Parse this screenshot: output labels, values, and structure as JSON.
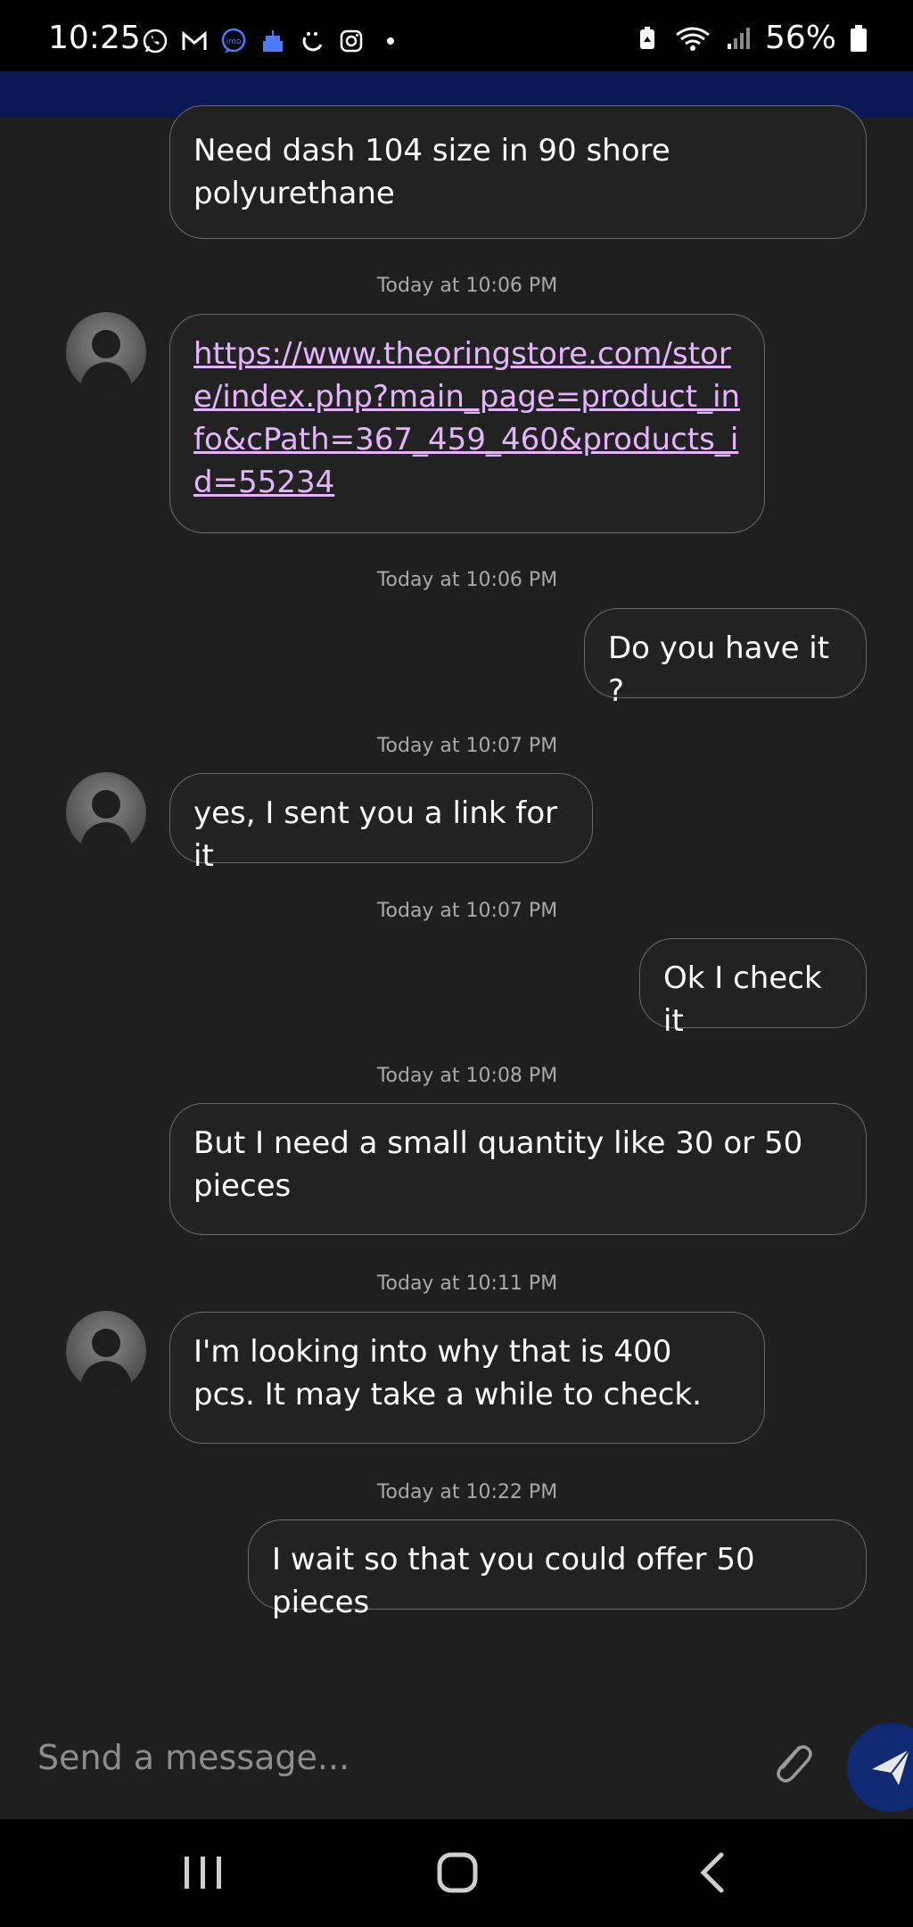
{
  "status_bar": {
    "time": "10:25",
    "battery": "56%",
    "icons": [
      "whatsapp-icon",
      "gmail-icon",
      "imo-icon",
      "cake-icon",
      "smile-app-icon",
      "instagram-icon",
      "dot-icon",
      "battery-saver-icon",
      "wifi-icon",
      "signal-icon",
      "battery-icon"
    ]
  },
  "chat": {
    "messages": [
      {
        "side": "right",
        "text": "Need dash 104 size in 90 shore polyurethane"
      },
      {
        "timestamp": "Today at 10:06 PM"
      },
      {
        "side": "left",
        "text": "https://www.theoringstore.com/store/index.php?main_page=product_info&cPath=367_459_460&products_id=55234",
        "is_link": true
      },
      {
        "timestamp": "Today at 10:06 PM"
      },
      {
        "side": "right",
        "text": "Do you have it ?"
      },
      {
        "timestamp": "Today at 10:07 PM"
      },
      {
        "side": "left",
        "text": "yes, I sent you a link for it"
      },
      {
        "timestamp": "Today at 10:07 PM"
      },
      {
        "side": "right",
        "text": "Ok I check it"
      },
      {
        "timestamp": "Today at 10:08 PM"
      },
      {
        "side": "right",
        "text": "But I need a small quantity like 30 or 50 pieces"
      },
      {
        "timestamp": "Today at 10:11 PM"
      },
      {
        "side": "left",
        "text": "I'm looking into why that is 400 pcs. It may take a while to check."
      },
      {
        "timestamp": "Today at 10:22 PM"
      },
      {
        "side": "right",
        "text": "I wait so that you could offer 50 pieces"
      }
    ],
    "bubbles": {
      "b1": "Need dash 104 size in 90 shore polyurethane",
      "b2_link": "https://www.theoringstore.com/store/index.php?main_page=product_info&cPath=367_459_460&products_id=55234",
      "b3": "Do you have it ?",
      "b4": "yes, I sent you a link for it",
      "b5": "Ok I check it",
      "b6": "But I need a small quantity like 30 or 50 pieces",
      "b7": "I'm looking into why that is 400 pcs. It may take a while to check.",
      "b8": "I wait so that you could offer 50 pieces"
    },
    "timestamps": {
      "t1": "Today at 10:06 PM",
      "t2": "Today at 10:06 PM",
      "t3": "Today at 10:07 PM",
      "t4": "Today at 10:07 PM",
      "t5": "Today at 10:08 PM",
      "t6": "Today at 10:11 PM",
      "t7": "Today at 10:22 PM"
    }
  },
  "composer": {
    "placeholder": "Send a message...",
    "value": ""
  },
  "colors": {
    "background": "#1f1f20",
    "header": "#0b1a55",
    "send_button": "#0f2a73",
    "link": "#e6b3ff",
    "bubble_border": "#6a6a6a"
  },
  "nav_bar": {
    "buttons": [
      "recent-apps-icon",
      "home-icon",
      "back-icon"
    ]
  }
}
